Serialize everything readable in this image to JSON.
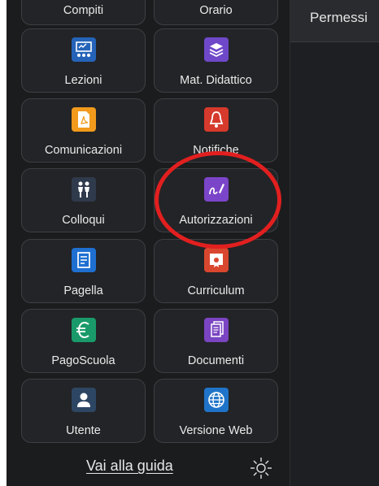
{
  "tiles": [
    {
      "label": "Compiti",
      "color": "#2a6db5",
      "icon": "homework-icon"
    },
    {
      "label": "Orario",
      "color": "#2a6db5",
      "icon": "timetable-icon"
    },
    {
      "label": "Lezioni",
      "color": "#2563b8",
      "icon": "lessons-icon"
    },
    {
      "label": "Mat. Didattico",
      "color": "#6f48c9",
      "icon": "books-icon"
    },
    {
      "label": "Comunicazioni",
      "color": "#f19a1c",
      "icon": "pdf-icon"
    },
    {
      "label": "Notifiche",
      "color": "#d63a2c",
      "icon": "bell-icon"
    },
    {
      "label": "Colloqui",
      "color": "#2f3a4c",
      "icon": "meeting-icon"
    },
    {
      "label": "Autorizzazioni",
      "color": "#7b45c9",
      "icon": "signature-icon"
    },
    {
      "label": "Pagella",
      "color": "#1e6fd0",
      "icon": "report-card-icon"
    },
    {
      "label": "Curriculum",
      "color": "#d9472f",
      "icon": "certificate-icon"
    },
    {
      "label": "PagoScuola",
      "color": "#1a9a6a",
      "icon": "euro-icon"
    },
    {
      "label": "Documenti",
      "color": "#7a44c2",
      "icon": "documents-icon"
    },
    {
      "label": "Utente",
      "color": "#2d4663",
      "icon": "user-icon"
    },
    {
      "label": "Versione Web",
      "color": "#1f74c9",
      "icon": "globe-icon"
    }
  ],
  "footer": {
    "guide_link": "Vai alla guida"
  },
  "theme_toggle": {
    "icon": "sun-icon"
  },
  "right_panel": {
    "header": "Permessi"
  },
  "highlight_color": "#e21f1f"
}
